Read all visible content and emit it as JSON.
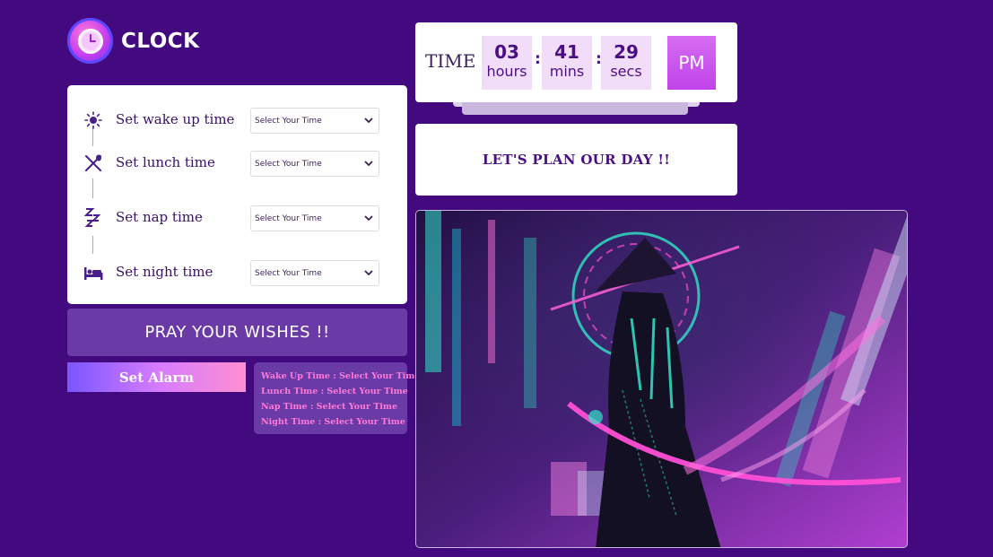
{
  "app": {
    "logo_text": "CLOCK"
  },
  "schedule": {
    "items": [
      {
        "label": "Set wake up time",
        "select_value": "Select Your Time",
        "icon": "sun-icon"
      },
      {
        "label": "Set lunch time",
        "select_value": "Select Your Time",
        "icon": "utensils-icon"
      },
      {
        "label": "Set nap time",
        "select_value": "Select Your Time",
        "icon": "sleep-zzz-icon"
      },
      {
        "label": "Set night time",
        "select_value": "Select Your Time",
        "icon": "bed-icon"
      }
    ]
  },
  "pray": {
    "text": "PRAY YOUR WISHES !!"
  },
  "alarm": {
    "button_label": "Set Alarm"
  },
  "summary": {
    "lines": [
      "Wake Up Time : Select Your Time",
      "Lunch Time : Select Your Time",
      "Nap Time : Select Your Time",
      "Night Time : Select Your Time"
    ]
  },
  "clock": {
    "label": "TIME",
    "hours": "03",
    "hours_unit": "hours",
    "mins": "41",
    "mins_unit": "mins",
    "secs": "29",
    "secs_unit": "secs",
    "colon": ":",
    "ampm": "PM"
  },
  "plan": {
    "text": "LET'S PLAN OUR DAY !!"
  },
  "colors": {
    "background": "#420a7e",
    "accent_pink": "#ff7ad9",
    "panel_purple": "#6a3aa6",
    "pm_magenta": "#c043ea"
  }
}
